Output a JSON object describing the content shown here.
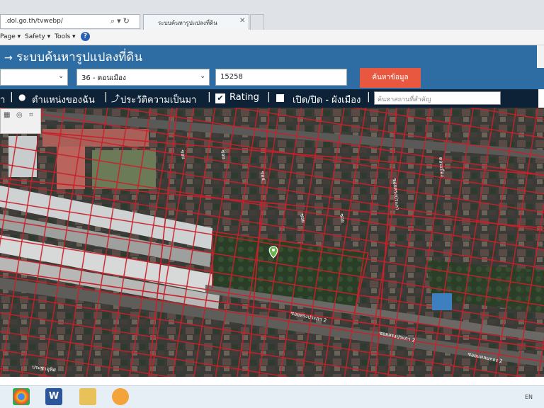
{
  "browser": {
    "url": ".dol.go.th/tvwebp/",
    "tab_title": "ระบบค้นหารูปแปลงที่ดิน",
    "menu": {
      "page": "Page ▾",
      "safety": "Safety ▾",
      "tools": "Tools ▾",
      "help": "?"
    }
  },
  "app": {
    "title": "ระบบค้นหารูปแปลงที่ดิน",
    "search": {
      "province_value": "",
      "district_value": "36 - ดอนเมือง",
      "parcel_value": "15258",
      "button_label": "ค้นหาข้อมูล"
    },
    "toolbar": {
      "first_label": "า",
      "location_label": "ตำแหน่งของฉัน",
      "history_label": "ประวัติความเป็นมา",
      "rating_label": "Rating",
      "cityplan_label": "เปิด/ปิด - ผังเมือง",
      "landmark_placeholder": "ค้นหาสถานที่สำคัญ"
    }
  },
  "map": {
    "road_labels": [
      "ซอย",
      "ซอย",
      "ซอย",
      "ซอย",
      "ซอย",
      "ซอยสรงประภา",
      "ดอนเมือง",
      "ซอยสรงประภา 2",
      "ซอยสรงประภา 2",
      "ซอยแหลมทอง 2",
      "ประชาอุทิศ"
    ],
    "parcel_color": "#c8202a",
    "marker_color": "#6ab34a"
  },
  "taskbar": {
    "lang": "EN"
  }
}
